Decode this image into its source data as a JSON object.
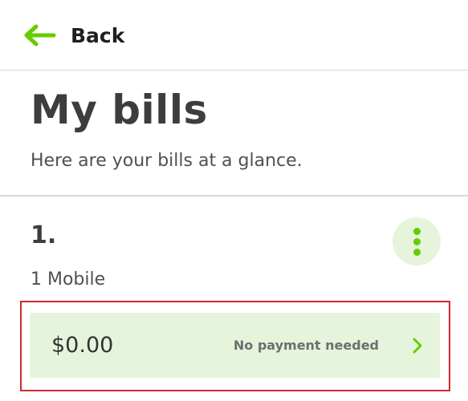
{
  "header": {
    "back_label": "Back"
  },
  "page": {
    "title": "My bills",
    "subtitle": "Here are your bills at a glance."
  },
  "bill": {
    "number": "1.",
    "description": "1 Mobile",
    "amount": "$0.00",
    "status": "No payment needed"
  },
  "colors": {
    "accent": "#66cc00",
    "card_background": "#e6f4dc",
    "highlight_border": "#d0282d",
    "text_dark": "#3d3d3d"
  },
  "icons": {
    "back": "arrow-left-icon",
    "menu": "more-vertical-icon",
    "card_arrow": "chevron-right-icon"
  }
}
